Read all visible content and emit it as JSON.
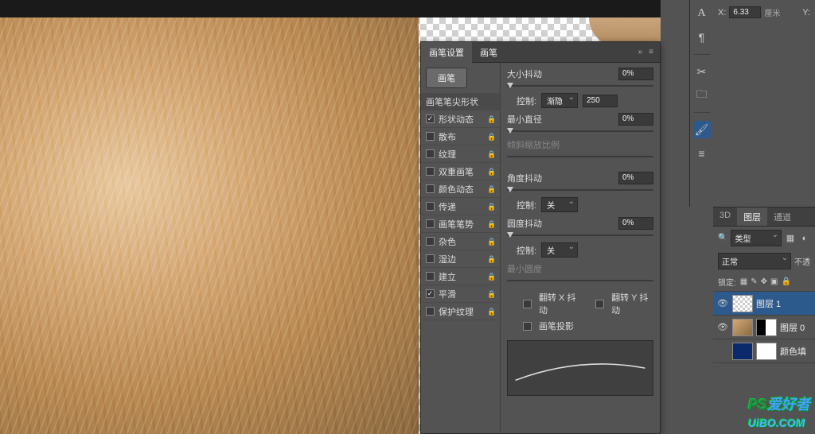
{
  "top_right": {
    "x_label": "X:",
    "x_value": "6.33",
    "x_unit": "厘米",
    "y_label": "Y:"
  },
  "brush_panel": {
    "tabs": {
      "settings": "画笔设置",
      "brushes": "画笔"
    },
    "menu_glyph": "»",
    "lines_glyph": "≡",
    "brush_button": "画笔",
    "tip_shape": "画笔笔尖形状",
    "options": [
      {
        "label": "形状动态",
        "checked": true,
        "locked": true,
        "dim": false
      },
      {
        "label": "散布",
        "checked": false,
        "locked": true,
        "dim": false
      },
      {
        "label": "纹理",
        "checked": false,
        "locked": true,
        "dim": false
      },
      {
        "label": "双重画笔",
        "checked": false,
        "locked": true,
        "dim": false
      },
      {
        "label": "颜色动态",
        "checked": false,
        "locked": true,
        "dim": false
      },
      {
        "label": "传递",
        "checked": false,
        "locked": true,
        "dim": false
      },
      {
        "label": "画笔笔势",
        "checked": false,
        "locked": true,
        "dim": false
      },
      {
        "label": "杂色",
        "checked": false,
        "locked": true,
        "dim": false
      },
      {
        "label": "湿边",
        "checked": false,
        "locked": true,
        "dim": false
      },
      {
        "label": "建立",
        "checked": false,
        "locked": true,
        "dim": false
      },
      {
        "label": "平滑",
        "checked": true,
        "locked": true,
        "dim": false
      },
      {
        "label": "保护纹理",
        "checked": false,
        "locked": true,
        "dim": false
      }
    ],
    "right": {
      "size_jitter": {
        "label": "大小抖动",
        "value": "0%"
      },
      "control1": {
        "label": "控制:",
        "select": "渐隐",
        "value": "250"
      },
      "min_diameter": {
        "label": "最小直径",
        "value": "0%"
      },
      "tilt_scale": {
        "label": "倾斜缩放比例"
      },
      "angle_jitter": {
        "label": "角度抖动",
        "value": "0%"
      },
      "control2": {
        "label": "控制:",
        "select": "关"
      },
      "roundness_jitter": {
        "label": "圆度抖动",
        "value": "0%"
      },
      "control3": {
        "label": "控制:",
        "select": "关"
      },
      "min_roundness": {
        "label": "最小圆度"
      },
      "flip_x": "翻转 X 抖动",
      "flip_y": "翻转 Y 抖动",
      "projection": "画笔投影"
    }
  },
  "layers": {
    "tabs": {
      "three_d": "3D",
      "layers": "图层",
      "channels": "通道"
    },
    "filter_label": "类型",
    "search_glyph": "🔍",
    "blend_mode": "正常",
    "opacity_label": "不透",
    "lock_label": "锁定:",
    "items": [
      {
        "name": "图层 1"
      },
      {
        "name": "图层 0"
      },
      {
        "name": "颜色填"
      }
    ]
  },
  "watermark": {
    "ps": "PS",
    "text": "爱好者",
    "url": "UiBO.COM"
  },
  "icons": {
    "lock": "🔒",
    "eye": "👁",
    "type": "A",
    "paragraph": "¶",
    "scissors": "✂",
    "folder": "🗀",
    "brush": "🖌",
    "sliders": "≡"
  }
}
